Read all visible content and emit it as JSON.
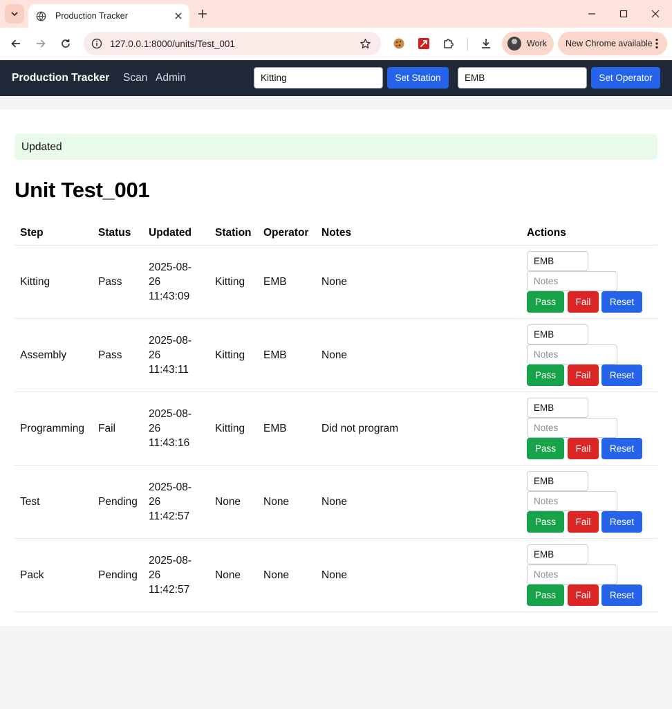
{
  "browser": {
    "tab_title": "Production Tracker",
    "url": "127.0.0.1:8000/units/Test_001",
    "profile_label": "Work",
    "update_label": "New Chrome available",
    "icons": [
      "tab-list-icon",
      "globe-icon",
      "close-icon",
      "plus-icon",
      "minimize-icon",
      "maximize-icon",
      "window-close-icon",
      "back-icon",
      "forward-icon",
      "reload-icon",
      "site-info-icon",
      "star-icon",
      "cookie-extension-icon",
      "pdf-extension-icon",
      "extensions-puzzle-icon",
      "download-icon",
      "kebab-menu-icon"
    ]
  },
  "nav": {
    "brand": "Production Tracker",
    "links": [
      "Scan",
      "Admin"
    ],
    "station_value": "Kitting",
    "set_station_label": "Set Station",
    "operator_value": "EMB",
    "set_operator_label": "Set Operator"
  },
  "flash": "Updated",
  "page_title": "Unit Test_001",
  "table": {
    "headers": [
      "Step",
      "Status",
      "Updated",
      "Station",
      "Operator",
      "Notes",
      "Actions"
    ],
    "rows": [
      {
        "step": "Kitting",
        "status": "Pass",
        "updated_date": "2025-08-",
        "updated_day": "26",
        "updated_time": "11:43:09",
        "station": "Kitting",
        "operator": "EMB",
        "notes": "None"
      },
      {
        "step": "Assembly",
        "status": "Pass",
        "updated_date": "2025-08-",
        "updated_day": "26",
        "updated_time": "11:43:11",
        "station": "Kitting",
        "operator": "EMB",
        "notes": "None"
      },
      {
        "step": "Programming",
        "status": "Fail",
        "updated_date": "2025-08-",
        "updated_day": "26",
        "updated_time": "11:43:16",
        "station": "Kitting",
        "operator": "EMB",
        "notes": "Did not program"
      },
      {
        "step": "Test",
        "status": "Pending",
        "updated_date": "2025-08-",
        "updated_day": "26",
        "updated_time": "11:42:57",
        "station": "None",
        "operator": "None",
        "notes": "None"
      },
      {
        "step": "Pack",
        "status": "Pending",
        "updated_date": "2025-08-",
        "updated_day": "26",
        "updated_time": "11:42:57",
        "station": "None",
        "operator": "None",
        "notes": "None"
      }
    ],
    "action": {
      "operator_value": "EMB",
      "notes_placeholder": "Notes",
      "pass_label": "Pass",
      "fail_label": "Fail",
      "reset_label": "Reset"
    }
  },
  "colors": {
    "nav_bg": "#1f2937",
    "primary": "#2563eb",
    "pass": "#16a34a",
    "fail": "#dc2626",
    "flash_bg": "#e8fbe8"
  }
}
